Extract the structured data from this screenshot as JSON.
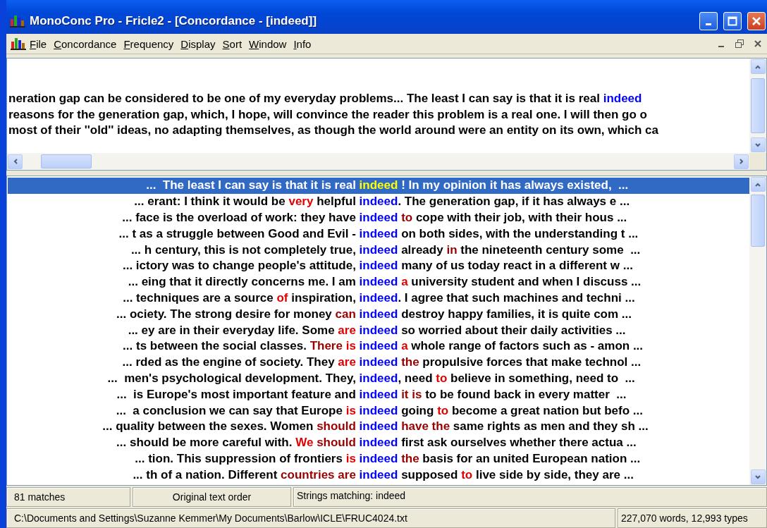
{
  "window": {
    "title": "MonoConc Pro - Fricle2 - [Concordance - [indeed]]"
  },
  "menu": [
    {
      "label": "File"
    },
    {
      "label": "Concordance"
    },
    {
      "label": "Frequency"
    },
    {
      "label": "Display"
    },
    {
      "label": "Sort"
    },
    {
      "label": "Window"
    },
    {
      "label": "Info"
    }
  ],
  "text_pane": {
    "lines": [
      [
        {
          "text": "neration gap can be considered to be one of my everyday problems... The least I can say is that it is real",
          "kind": "plain"
        },
        {
          "text": "indeed",
          "kind": "key"
        }
      ],
      [
        {
          "text": "reasons for the generation gap, which, I hope, will convince the reader this problem is a real one. I will then go o",
          "kind": "plain"
        }
      ],
      [
        {
          "text": "most of their ''old'' ideas, no adapting themselves, as though the world around were an entity on its own, which ca",
          "kind": "plain"
        }
      ]
    ]
  },
  "concordance": {
    "rows": [
      {
        "selected": true,
        "left": [
          {
            "text": "...  The least I can say is that it is real",
            "kind": "plain"
          }
        ],
        "key": "indeed",
        "right": [
          {
            "text": "! In my opinion it has always existed,  ...",
            "kind": "plain"
          }
        ]
      },
      {
        "selected": false,
        "left": [
          {
            "text": "... erant: I think it would be",
            "kind": "plain"
          },
          {
            "text": "very",
            "kind": "red"
          },
          {
            "text": "helpful",
            "kind": "plain"
          }
        ],
        "key": "indeed",
        "right": [
          {
            "text": ". The generation gap, if it has always e ...",
            "kind": "plain",
            "joined": true
          }
        ]
      },
      {
        "selected": false,
        "left": [
          {
            "text": "... face is the overload of work: they have",
            "kind": "plain"
          }
        ],
        "key": "indeed",
        "right": [
          {
            "text": "to",
            "kind": "darkred"
          },
          {
            "text": "cope with their job, with their hous ...",
            "kind": "plain"
          }
        ]
      },
      {
        "selected": false,
        "left": [
          {
            "text": "... t as a struggle between Good and Evil -",
            "kind": "plain"
          }
        ],
        "key": "indeed",
        "right": [
          {
            "text": "on both sides, with the understanding t ...",
            "kind": "plain"
          }
        ]
      },
      {
        "selected": false,
        "left": [
          {
            "text": "... h century, this is not completely true,",
            "kind": "plain"
          }
        ],
        "key": "indeed",
        "right": [
          {
            "text": "already",
            "kind": "plain"
          },
          {
            "text": "in",
            "kind": "darkred"
          },
          {
            "text": "the nineteenth century some  ...",
            "kind": "plain"
          }
        ]
      },
      {
        "selected": false,
        "left": [
          {
            "text": "... ictory was to change people's attitude,",
            "kind": "plain"
          }
        ],
        "key": "indeed",
        "right": [
          {
            "text": "many of us today react in a different w ...",
            "kind": "plain"
          }
        ]
      },
      {
        "selected": false,
        "left": [
          {
            "text": "... eing that it directly concerns me. I am",
            "kind": "plain"
          }
        ],
        "key": "indeed",
        "right": [
          {
            "text": "a",
            "kind": "red"
          },
          {
            "text": "university student and when I discuss ...",
            "kind": "plain"
          }
        ]
      },
      {
        "selected": false,
        "left": [
          {
            "text": "... techniques are a source",
            "kind": "plain"
          },
          {
            "text": "of",
            "kind": "red"
          },
          {
            "text": "inspiration,",
            "kind": "plain"
          }
        ],
        "key": "indeed",
        "right": [
          {
            "text": ". I agree that such machines and techni ...",
            "kind": "plain",
            "joined": true
          }
        ]
      },
      {
        "selected": false,
        "left": [
          {
            "text": "... ociety. The strong desire for money",
            "kind": "plain"
          },
          {
            "text": "can",
            "kind": "darkred"
          }
        ],
        "key": "indeed",
        "right": [
          {
            "text": "destroy happy families, it is quite com ...",
            "kind": "plain"
          }
        ]
      },
      {
        "selected": false,
        "left": [
          {
            "text": "... ey are in their everyday life. Some",
            "kind": "plain"
          },
          {
            "text": "are",
            "kind": "red"
          }
        ],
        "key": "indeed",
        "right": [
          {
            "text": "so worried about their daily activities ...",
            "kind": "plain"
          }
        ]
      },
      {
        "selected": false,
        "left": [
          {
            "text": "... ts between the social classes.",
            "kind": "plain"
          },
          {
            "text": "There",
            "kind": "darkred"
          },
          {
            "text": "is",
            "kind": "red"
          }
        ],
        "key": "indeed",
        "right": [
          {
            "text": "a",
            "kind": "red"
          },
          {
            "text": "whole range of factors such as - amon ...",
            "kind": "plain"
          }
        ]
      },
      {
        "selected": false,
        "left": [
          {
            "text": "... rded as the engine of society. They",
            "kind": "plain"
          },
          {
            "text": "are",
            "kind": "red"
          }
        ],
        "key": "indeed",
        "right": [
          {
            "text": "the",
            "kind": "darkred"
          },
          {
            "text": "propulsive forces that make technol ...",
            "kind": "plain"
          }
        ]
      },
      {
        "selected": false,
        "left": [
          {
            "text": "...  men's psychological development. They,",
            "kind": "plain"
          }
        ],
        "key": "indeed",
        "right": [
          {
            "text": ", need",
            "kind": "plain",
            "joined": true
          },
          {
            "text": "to",
            "kind": "red"
          },
          {
            "text": "believe in something, need to  ...",
            "kind": "plain"
          }
        ]
      },
      {
        "selected": false,
        "left": [
          {
            "text": "...  is Europe's most important feature and",
            "kind": "plain"
          }
        ],
        "key": "indeed",
        "right": [
          {
            "text": "it is",
            "kind": "darkred"
          },
          {
            "text": "to be found back in every matter  ...",
            "kind": "plain"
          }
        ]
      },
      {
        "selected": false,
        "left": [
          {
            "text": "...  a conclusion we can say that Europe",
            "kind": "plain"
          },
          {
            "text": "is",
            "kind": "red"
          }
        ],
        "key": "indeed",
        "right": [
          {
            "text": "going",
            "kind": "plain"
          },
          {
            "text": "to",
            "kind": "red"
          },
          {
            "text": "become a great nation but befo ...",
            "kind": "plain"
          }
        ]
      },
      {
        "selected": false,
        "left": [
          {
            "text": "... quality between the sexes. Women",
            "kind": "plain"
          },
          {
            "text": "should",
            "kind": "darkred"
          }
        ],
        "key": "indeed",
        "right": [
          {
            "text": "have the",
            "kind": "darkred"
          },
          {
            "text": "same rights as men and they sh ...",
            "kind": "plain"
          }
        ]
      },
      {
        "selected": false,
        "left": [
          {
            "text": "... should be more careful with.",
            "kind": "plain"
          },
          {
            "text": "We",
            "kind": "red"
          },
          {
            "text": "should",
            "kind": "darkred"
          }
        ],
        "key": "indeed",
        "right": [
          {
            "text": "first ask ourselves whether there actua ...",
            "kind": "plain"
          }
        ]
      },
      {
        "selected": false,
        "left": [
          {
            "text": "... tion. This suppression of frontiers",
            "kind": "plain"
          },
          {
            "text": "is",
            "kind": "red"
          }
        ],
        "key": "indeed",
        "right": [
          {
            "text": "the",
            "kind": "darkred"
          },
          {
            "text": "basis for an united European nation ...",
            "kind": "plain"
          }
        ]
      },
      {
        "selected": false,
        "left": [
          {
            "text": "... th of a nation. Different",
            "kind": "plain"
          },
          {
            "text": "countries",
            "kind": "darkred"
          },
          {
            "text": "are",
            "kind": "darkred"
          }
        ],
        "key": "indeed",
        "right": [
          {
            "text": "supposed",
            "kind": "plain"
          },
          {
            "text": "to",
            "kind": "red"
          },
          {
            "text": "live side by side, they are ...",
            "kind": "plain"
          }
        ]
      }
    ]
  },
  "status_bar": {
    "matches": "81 matches",
    "sort_order": "Original text order",
    "search": "Strings matching: indeed",
    "file_path": "C:\\Documents and Settings\\Suzanne Kemmer\\My Documents\\Barlow\\ICLE\\FRUC4024.txt",
    "counts": "227,070 words, 12,993 types"
  }
}
